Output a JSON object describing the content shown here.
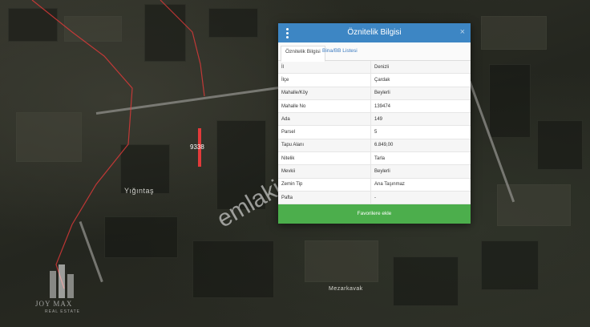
{
  "map": {
    "labels": {
      "village_left": "Yığıntaş",
      "village_bottom": "Mezarkavak",
      "parcel_number": "9338"
    },
    "watermark": "emlakjet.com",
    "logo_text": "JOY MAX",
    "logo_subtext": "REAL ESTATE",
    "colors": {
      "boundary": "#e23a3a",
      "header": "#3d86c4",
      "button": "#4cae4c"
    }
  },
  "dialog": {
    "title": "Öznitelik Bilgisi",
    "close_label": "×",
    "menu_icon": "vertical-dots-icon",
    "tabs": [
      {
        "label": "Öznitelik Bilgisi",
        "active": true
      },
      {
        "label": "Bina/BB Listesi",
        "active": false
      }
    ],
    "rows": [
      {
        "key": "İl",
        "value": "Denizli"
      },
      {
        "key": "İlçe",
        "value": "Çardak"
      },
      {
        "key": "Mahalle/Köy",
        "value": "Beylerli"
      },
      {
        "key": "Mahalle No",
        "value": "139474"
      },
      {
        "key": "Ada",
        "value": "149"
      },
      {
        "key": "Parsel",
        "value": "5"
      },
      {
        "key": "Tapu Alanı",
        "value": "6.849,00"
      },
      {
        "key": "Nitelik",
        "value": "Tarla"
      },
      {
        "key": "Mevkii",
        "value": "Beylerli"
      },
      {
        "key": "Zemin Tip",
        "value": "Ana Taşınmaz"
      },
      {
        "key": "Pafta",
        "value": "-"
      }
    ],
    "favorite_button": "Favorilere ekle"
  }
}
